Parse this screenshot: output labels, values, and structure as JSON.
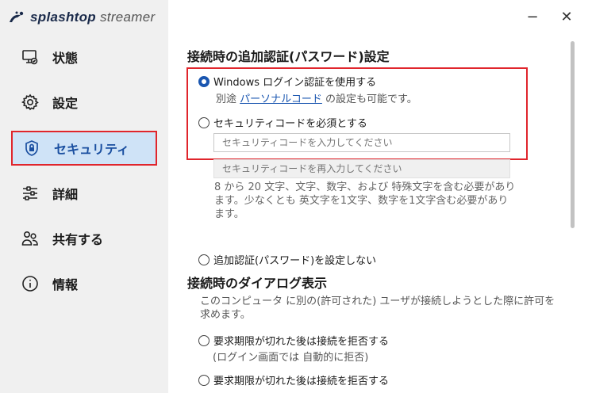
{
  "app": {
    "logo_bold": "splashtop",
    "logo_light": "streamer",
    "minimize": "−",
    "close": "✕"
  },
  "sidebar": {
    "items": [
      {
        "label": "状態"
      },
      {
        "label": "設定"
      },
      {
        "label": "セキュリティ"
      },
      {
        "label": "詳細"
      },
      {
        "label": "共有する"
      },
      {
        "label": "情報"
      }
    ],
    "active": "セキュリティ"
  },
  "security": {
    "section_title": "接続時の追加認証(パスワード)設定",
    "option_windows": "Windows ログイン認証を使用する",
    "windows_sub_prefix": "別途",
    "windows_sub_link": "パーソナルコード",
    "windows_sub_suffix": "の設定も可能です。",
    "option_code": "セキュリティコードを必須とする",
    "code_placeholder": "セキュリティコードを入力してください",
    "code_confirm_placeholder": "セキュリティコードを再入力してください",
    "code_note": "8 から 20 文字、文字、数字、および 特殊文字を含む必要があります。少なくとも 英文字を1文字、数字を1文字含む必要があります。",
    "option_none": "追加認証(パスワード)を設定しない",
    "selected": "Windows ログイン認証を使用する"
  },
  "dialog": {
    "section_title": "接続時のダイアログ表示",
    "description": "このコンピュータ に別の(許可された) ユーザが接続しようとした際に許可を求めます。",
    "option_reject": "要求期限が切れた後は接続を拒否する",
    "option_reject_sub": "(ログイン画面では 自動的に拒否)",
    "option_reject_2": "要求期限が切れた後は接続を拒否する"
  }
}
